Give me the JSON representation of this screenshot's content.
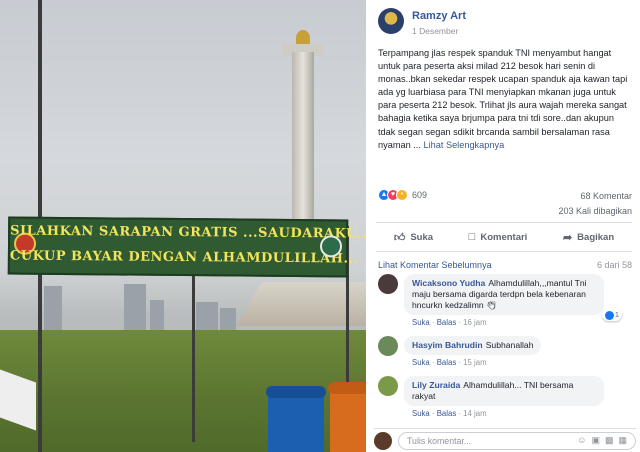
{
  "photo": {
    "banner_line1": "SILAHKAN SARAPAN GRATIS ...SAUDARAKU...",
    "banner_line2": "CUKUP BAYAR DENGAN ALHAMDULILLAH..."
  },
  "post": {
    "author": "Ramzy Art",
    "time": "1 Desember",
    "caption": "Terpampang jlas respek spanduk TNI menyambut hangat untuk para peserta aksi milad 212 besok hari senin di monas..bkan sekedar respek ucapan spanduk aja kawan tapi ada yg luarbiasa para TNI menyiapkan mkanan juga untuk para peserta 212 besok. Trlihat jls aura wajah mereka sangat bahagia ketika saya brjumpa para tni tdi sore..dan akupun tdak segan segan sdikit brcanda sambil bersalaman rasa nyaman ...",
    "see_more": "Lihat Selengkapnya",
    "reaction_count": "609",
    "comment_count": "68 Komentar",
    "share_count": "203 Kali dibagikan",
    "actions": {
      "like": "Suka",
      "comment": "Komentari",
      "share": "Bagikan"
    },
    "colors": {
      "link": "#385898",
      "like": "#1877f2",
      "love": "#f33e58",
      "sad": "#f7b125"
    }
  },
  "comments": {
    "previous_link": "Lihat Komentar Sebelumnya",
    "count_of": "6 dari 58",
    "items": [
      {
        "name": "Wicaksono Yudha",
        "text": "Alhamdulillah,,,mantul Tni maju bersama digarda terdpn bela kebenaran hncurkn kedzalimn",
        "like": "Suka",
        "reply": "Balas",
        "time": "16 jam",
        "likes": "1"
      },
      {
        "name": "Hasyim Bahrudin",
        "text": "Subhanallah",
        "like": "Suka",
        "reply": "Balas",
        "time": "15 jam"
      },
      {
        "name": "Lily Zuraida",
        "text": "Alhamdulillah... TNI bersama rakyat",
        "like": "Suka",
        "reply": "Balas",
        "time": "14 jam"
      }
    ],
    "compose_placeholder": "Tulis komentar..."
  }
}
